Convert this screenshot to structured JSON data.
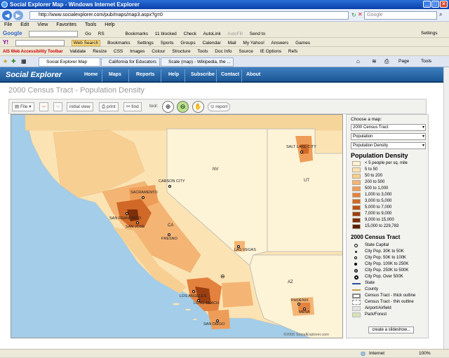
{
  "window": {
    "title": "Social Explorer Map - Windows Internet Explorer"
  },
  "address": {
    "url": "http://www.socialexplorer.com/pub/maps/map3.aspx?g=0",
    "search_placeholder": "Google"
  },
  "menu": [
    "File",
    "Edit",
    "View",
    "Favorites",
    "Tools",
    "Help"
  ],
  "google_toolbar": [
    "Google",
    "Go",
    "RS",
    "Bookmarks",
    "11 blocked",
    "Check",
    "AutoLink",
    "AutoFill",
    "Send to",
    "Settings"
  ],
  "yahoo_toolbar": [
    "Y!",
    "Web Search",
    "Bookmarks",
    "Settings",
    "Sports",
    "Groups",
    "Calendar",
    "Mail",
    "My Yahoo!",
    "Answers",
    "Games"
  ],
  "ais_toolbar": [
    "AIS Web Accessibility Toolbar",
    "Validate",
    "Resize",
    "CSS",
    "Images",
    "Colour",
    "Structure",
    "Tools",
    "Doc Info",
    "Source",
    "IE Options",
    "Refs"
  ],
  "tabs": [
    {
      "label": "Social Explorer Map"
    },
    {
      "label": "California for Educators"
    },
    {
      "label": "Scale (map) - Wikipedia, the ..."
    }
  ],
  "ie_commands": [
    "Page",
    "Tools"
  ],
  "site": {
    "logo": "Social Explorer",
    "nav": [
      "Home",
      "Maps",
      "Reports",
      "Help",
      "Subscribe",
      "Contact",
      "About"
    ],
    "page_title": "2000 Census Tract - Population Density"
  },
  "maptools": {
    "file": "File",
    "initial_view": "initial view",
    "print": "print",
    "find": "find",
    "tool_label": "tool:",
    "report": "report"
  },
  "map": {
    "labels": {
      "nv": "NV",
      "ut": "UT",
      "ca": "CA",
      "az": "AZ",
      "salt_lake": "SALT LAKE CITY",
      "carson": "CARSON CITY",
      "sacramento": "SACRAMENTO",
      "san_francisco": "SAN FRANCISCO",
      "san_jose": "SAN JOSE",
      "fresno": "FRESNO",
      "las_vegas": "LAS VEGAS",
      "los_angeles": "LOS ANGELES",
      "long_beach": "LONG BEACH",
      "san_diego": "SAN DIEGO",
      "phoenix": "PHOENIX",
      "mesa": "MESA"
    },
    "copyright": "©2006 SocialExplorer.com"
  },
  "sidebar": {
    "choose_label": "Choose a map:",
    "selects": [
      "2000 Census Tract",
      "Population",
      "Population Density"
    ],
    "legend_title": "Population Density",
    "legend": [
      {
        "label": "< 5 people per sq. mile",
        "color": "#fdf3d6"
      },
      {
        "label": "5 to 50",
        "color": "#fbe3b3"
      },
      {
        "label": "50 to 200",
        "color": "#f8cf92"
      },
      {
        "label": "200 to 500",
        "color": "#f4b574"
      },
      {
        "label": "500 to 1,000",
        "color": "#ee9d58"
      },
      {
        "label": "1,000 to 3,000",
        "color": "#e3823e"
      },
      {
        "label": "3,000 to 5,000",
        "color": "#d06827"
      },
      {
        "label": "5,000 to 7,000",
        "color": "#b9521a"
      },
      {
        "label": "7,000 to 9,000",
        "color": "#9c3f10"
      },
      {
        "label": "9,000 to 15,000",
        "color": "#7d2f0a"
      },
      {
        "label": "15,000 to 229,783",
        "color": "#5a1f05"
      }
    ],
    "census_title": "2000 Census Tract",
    "symbols": [
      "State Capital",
      "City Pop. 30K to 50K",
      "City Pop. 50K to 100K",
      "City Pop. 100K to 250K",
      "City Pop. 250K to 500K",
      "City Pop. Over 500K",
      "State",
      "County",
      "Census Tract - thick outline",
      "Census Tract - thin outline",
      "Airport/Airfield",
      "Park/Forest"
    ],
    "slideshow": "create a slideshow..."
  },
  "status": {
    "zone": "Internet",
    "zoom": "100%"
  }
}
